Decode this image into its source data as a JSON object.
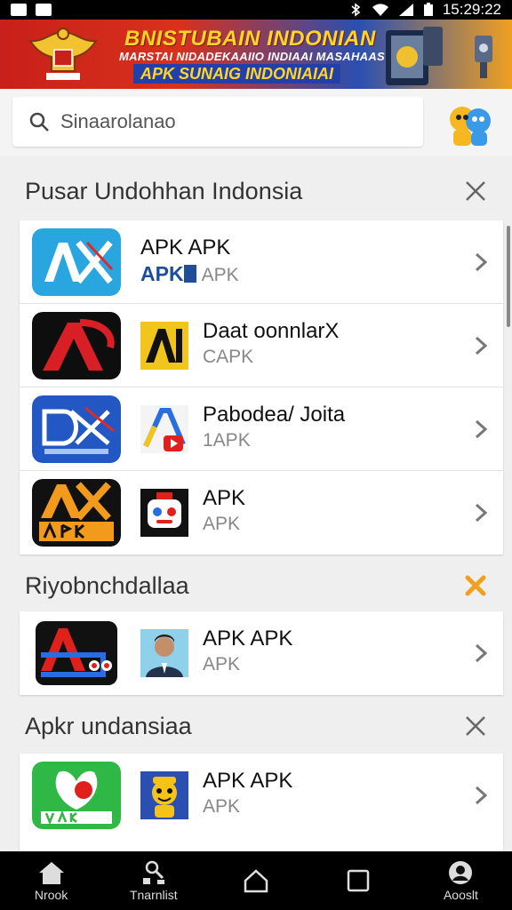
{
  "status_bar": {
    "time": "15:29:22"
  },
  "banner": {
    "title": "BNISTUBAIN INDONIAN",
    "subtitle": "MARSTAI NIDADEKAAIIO INDIAAI MASAHAAS",
    "tagline": "APK SUNAIG INDONIAIAI"
  },
  "search": {
    "placeholder": "Sinaarolanao"
  },
  "sections": [
    {
      "title": "Pusar Undohhan Indonsia",
      "items": [
        {
          "name": "APK APK",
          "sub_prefix": "APK",
          "sub": "APK"
        },
        {
          "name": "Daat oonnlarX",
          "sub": "CAPK"
        },
        {
          "name": "Pabodea/ Joita",
          "sub": "1APK"
        },
        {
          "name": "APK",
          "sub": "APK"
        }
      ]
    },
    {
      "title": "Riyobnchdallaa",
      "items": [
        {
          "name": "APK APK",
          "sub": "APK"
        }
      ]
    },
    {
      "title": "Apkr undansiaa",
      "items": [
        {
          "name": "APK APK",
          "sub": "APK"
        }
      ]
    }
  ],
  "nav": [
    {
      "label": "Nrook",
      "icon": "home-icon"
    },
    {
      "label": "Tnarnlist",
      "icon": "podium-icon"
    },
    {
      "label": "",
      "icon": "home-outline-icon"
    },
    {
      "label": "",
      "icon": "square-icon"
    },
    {
      "label": "Aooslt",
      "icon": "account-icon"
    }
  ],
  "colors": {
    "accent_orange": "#f0a020",
    "banner_red": "#c8201a",
    "banner_blue": "#2a4fb0",
    "apk_blue": "#1d4e9c"
  }
}
